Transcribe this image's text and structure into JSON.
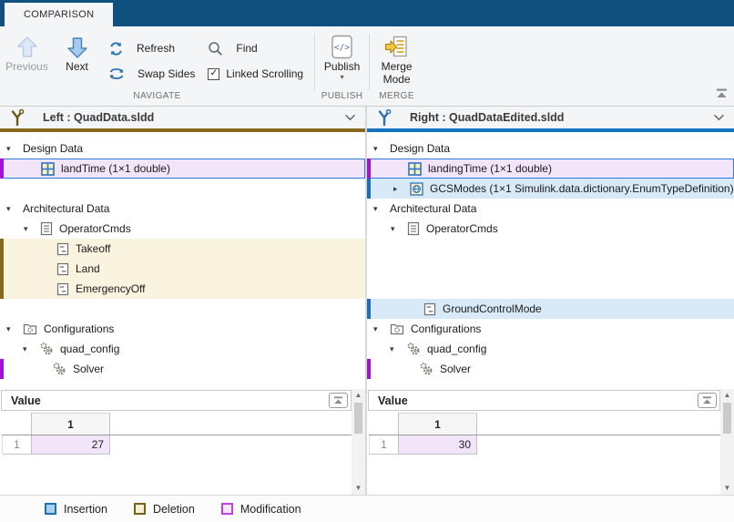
{
  "window": {
    "tab": "COMPARISON"
  },
  "toolbar": {
    "previous": "Previous",
    "next": "Next",
    "refresh": "Refresh",
    "swap_sides": "Swap Sides",
    "find": "Find",
    "linked_scrolling": "Linked Scrolling",
    "linked_scrolling_checked": "✓",
    "publish": "Publish",
    "merge_mode": {
      "line1": "Merge",
      "line2": "Mode"
    },
    "groups": {
      "navigate": "NAVIGATE",
      "publish": "PUBLISH",
      "merge": "MERGE"
    }
  },
  "left_panel": {
    "title": "Left : QuadData.sldd",
    "rows": [
      {
        "label": "Design Data"
      },
      {
        "label": "landTime  (1×1 double)"
      },
      {
        "label": ""
      },
      {
        "label": "Architectural Data"
      },
      {
        "label": "OperatorCmds"
      },
      {
        "label": "Takeoff"
      },
      {
        "label": "Land"
      },
      {
        "label": "EmergencyOff"
      },
      {
        "label": ""
      },
      {
        "label": "Configurations"
      },
      {
        "label": "quad_config"
      },
      {
        "label": "Solver"
      }
    ],
    "value": {
      "title": "Value",
      "col_header": "1",
      "row_header": "1",
      "cell": "27"
    }
  },
  "right_panel": {
    "title": "Right : QuadDataEdited.sldd",
    "rows": [
      {
        "label": "Design Data"
      },
      {
        "label": "landingTime  (1×1 double)"
      },
      {
        "label": "GCSModes  (1×1 Simulink.data.dictionary.EnumTypeDefinition)"
      },
      {
        "label": "Architectural Data"
      },
      {
        "label": "OperatorCmds"
      },
      {
        "label": ""
      },
      {
        "label": ""
      },
      {
        "label": ""
      },
      {
        "label": "GroundControlMode"
      },
      {
        "label": "Configurations"
      },
      {
        "label": "quad_config"
      },
      {
        "label": "Solver"
      }
    ],
    "value": {
      "title": "Value",
      "col_header": "1",
      "row_header": "1",
      "cell": "30"
    }
  },
  "legend": {
    "items": [
      {
        "label": "Insertion",
        "fill": "#aad2f0",
        "border": "#1f6fb5"
      },
      {
        "label": "Deletion",
        "fill": "#f6eed6",
        "border": "#776012"
      },
      {
        "label": "Modification",
        "fill": "#f6e9fb",
        "border": "#c43fe0"
      }
    ]
  },
  "colors": {
    "titlebar": "#11517f",
    "left_accent": "#87691b",
    "right_accent": "#1072c0",
    "selection_border": "#2b7cd8",
    "modification_bar": "#a213d8",
    "insertion_bar": "#1a6fba",
    "deletion_bar": "#87691b",
    "modification_bg": "#f2e4f9",
    "insertion_bg": "#d8eaf8",
    "deletion_bg": "#faf3df"
  },
  "icons": {
    "previous": "arrow-up",
    "next": "arrow-down",
    "refresh": "circular-arrows",
    "swap_sides": "swap-arrows",
    "find": "magnifier",
    "linked_scrolling": "checkbox-checked",
    "publish": "code-document",
    "merge_mode": "document-merge-arrow",
    "panel_header": "dictionary-compare-branch",
    "value_collapse": "collapse-panel",
    "ribbon_minimize": "collapse-ribbon"
  }
}
